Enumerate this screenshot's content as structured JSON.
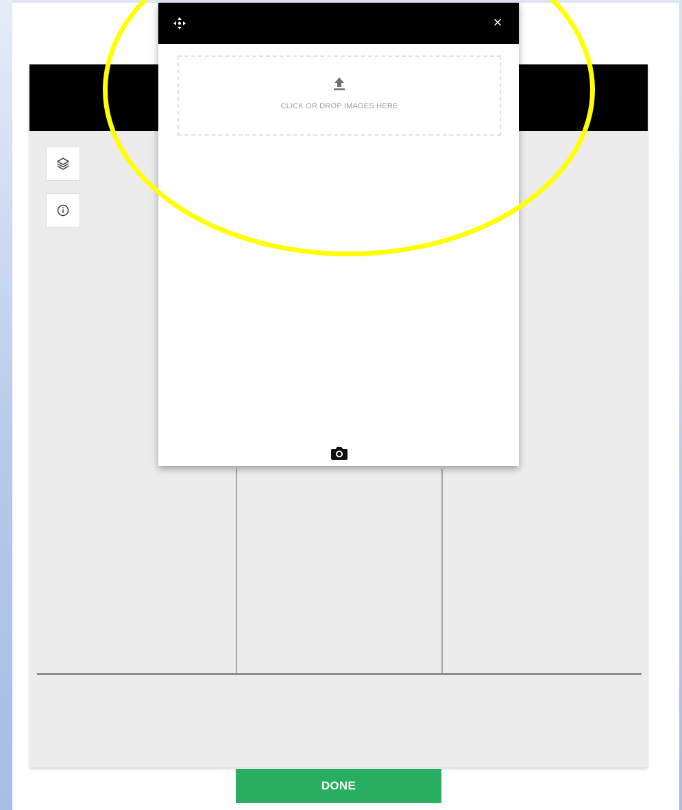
{
  "dialog": {
    "dropzone_label": "CLICK OR DROP IMAGES HERE",
    "close_label": "×",
    "move_icon": "move-arrows-icon",
    "upload_icon": "upload-arrow-icon",
    "camera_icon": "camera-icon"
  },
  "toolbar": {
    "layers_icon": "layers-icon",
    "info_icon": "info-icon"
  },
  "footer": {
    "done_label": "DONE"
  },
  "colors": {
    "header": "#000000",
    "canvas": "#ececec",
    "done_button": "#27ae60",
    "highlight": "#ffff00"
  }
}
